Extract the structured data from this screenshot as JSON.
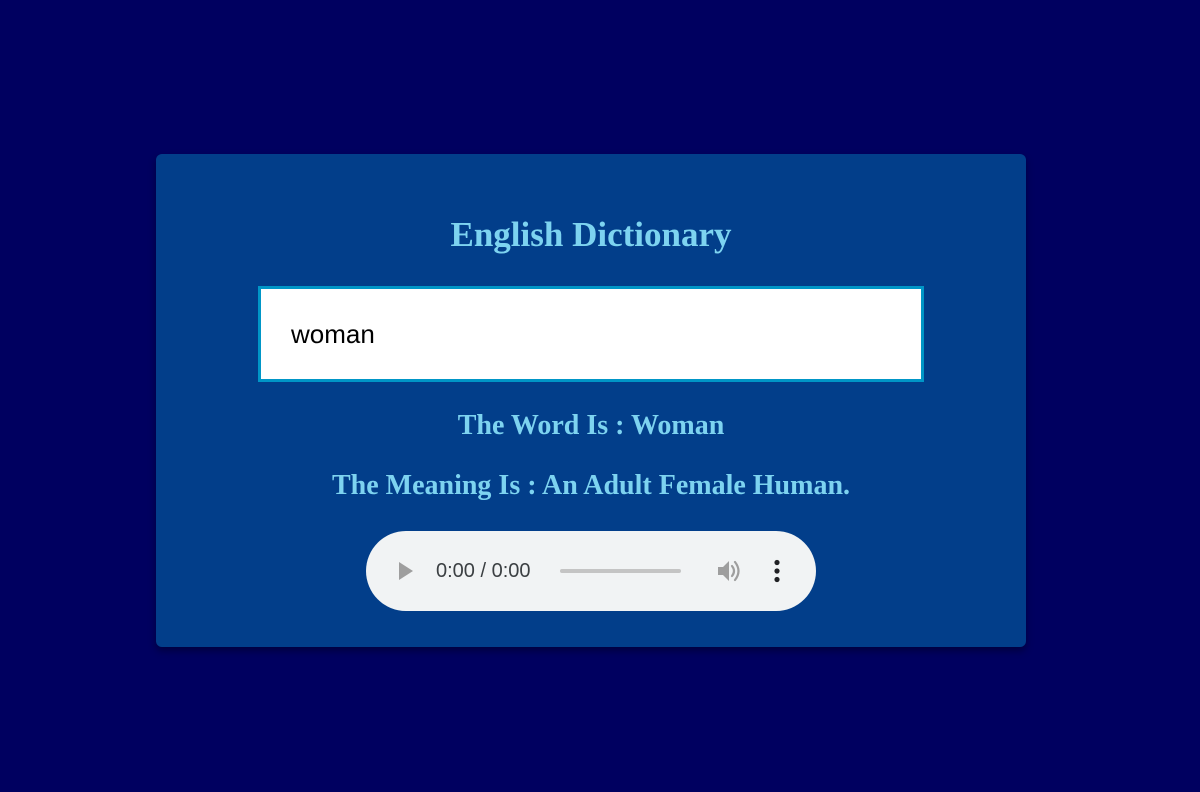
{
  "app": {
    "title": "English Dictionary"
  },
  "search": {
    "value": "woman",
    "placeholder": ""
  },
  "result": {
    "word_line": "The Word Is : Woman",
    "meaning_line": "The Meaning Is : An Adult Female Human."
  },
  "audio_player": {
    "time_display": "0:00 / 0:00",
    "progress": 0,
    "icons": {
      "play": "play-icon",
      "volume": "volume-icon",
      "menu": "more-vert-icon"
    }
  },
  "colors": {
    "page_background": "#000060",
    "card_background": "#023e8a",
    "heading_text": "#7dd3f0",
    "input_border": "#0096c7",
    "player_background": "#f1f3f4"
  }
}
